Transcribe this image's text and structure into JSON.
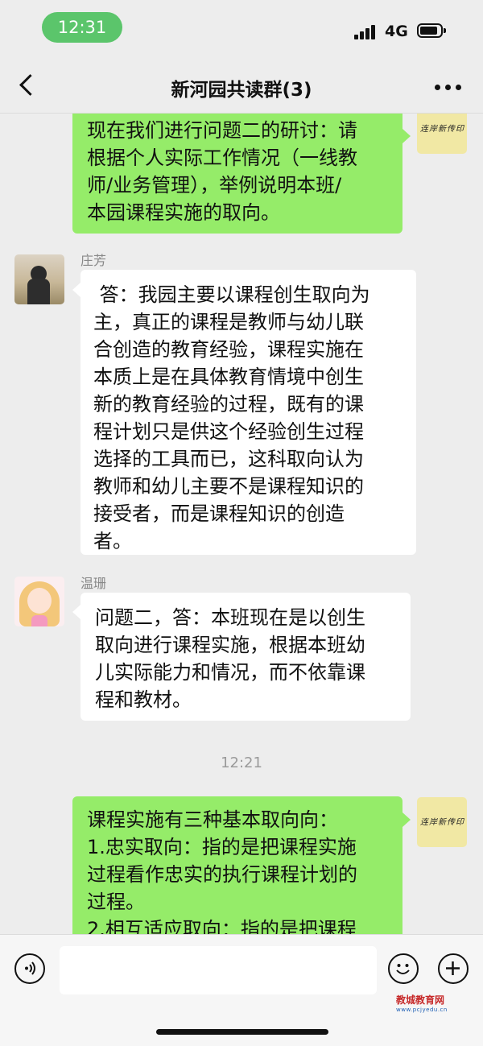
{
  "status_bar": {
    "time": "12:31",
    "network": "4G"
  },
  "header": {
    "title": "新河园共读群(3)"
  },
  "messages": [
    {
      "sender": "self",
      "text": "现在我们进行问题二的研讨：请\n根据个人实际工作情况（一线教\n师/业务管理），举例说明本班/\n本园课程实施的取向。"
    },
    {
      "sender": "庄芳",
      "text": " 答：我园主要以课程创生取向为\n主，真正的课程是教师与幼儿联\n合创造的教育经验，课程实施在\n本质上是在具体教育情境中创生\n新的教育经验的过程，既有的课\n程计划只是供这个经验创生过程\n选择的工具而已，这科取向认为\n教师和幼儿主要不是课程知识的\n接受者，而是课程知识的创造\n者。"
    },
    {
      "sender": "温珊",
      "text": "问题二，答：本班现在是以创生\n取向进行课程实施，根据本班幼\n儿实际能力和情况，而不依靠课\n程和教材。"
    },
    {
      "divider": "12:21"
    },
    {
      "sender": "self",
      "text": "课程实施有三种基本取向向：\n1.忠实取向：指的是把课程实施\n过程看作忠实的执行课程计划的\n过程。\n2.相互适应取向：指的是把课程"
    }
  ],
  "self_avatar_text": "连岸新传印",
  "watermark": {
    "name": "教城教育网",
    "url": "www.pcjyedu.cn"
  },
  "colors": {
    "bubble_out": "#95ec69",
    "bubble_in": "#ffffff",
    "status_pill": "#5bc56b"
  },
  "icons": [
    "back-icon",
    "more-icon",
    "voice-icon",
    "emoji-icon",
    "plus-icon"
  ]
}
